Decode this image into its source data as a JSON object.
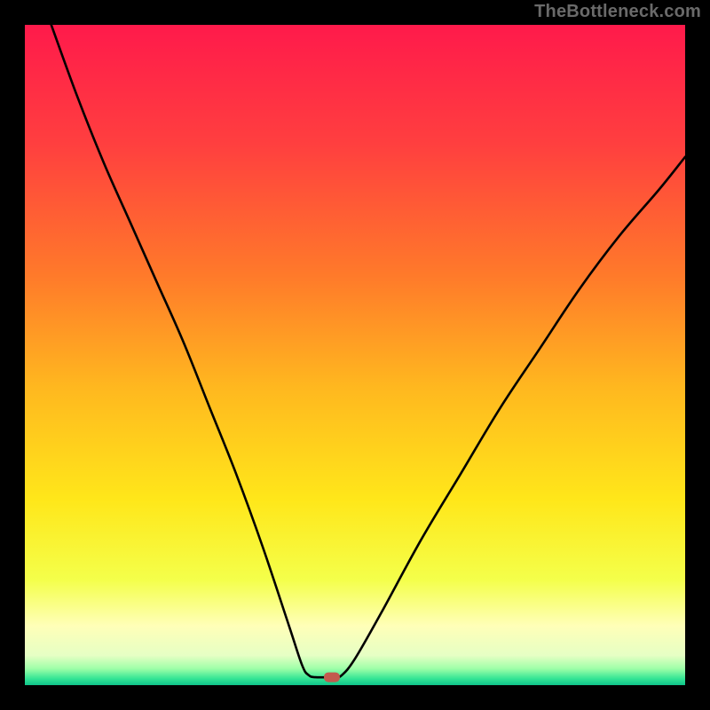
{
  "watermark": "TheBottleneck.com",
  "chart_data": {
    "type": "line",
    "title": "",
    "xlabel": "",
    "ylabel": "",
    "xlim": [
      0,
      100
    ],
    "ylim": [
      0,
      100
    ],
    "grid": false,
    "legend": false,
    "curve_points": [
      {
        "x": 4,
        "y": 100
      },
      {
        "x": 8,
        "y": 89
      },
      {
        "x": 12,
        "y": 79
      },
      {
        "x": 16,
        "y": 70
      },
      {
        "x": 20,
        "y": 61
      },
      {
        "x": 24,
        "y": 52
      },
      {
        "x": 28,
        "y": 42
      },
      {
        "x": 32,
        "y": 32
      },
      {
        "x": 36,
        "y": 21
      },
      {
        "x": 40,
        "y": 9
      },
      {
        "x": 42,
        "y": 3
      },
      {
        "x": 43,
        "y": 1.5
      },
      {
        "x": 44,
        "y": 1.2
      },
      {
        "x": 46,
        "y": 1.2
      },
      {
        "x": 47,
        "y": 1.2
      },
      {
        "x": 48,
        "y": 1.5
      },
      {
        "x": 50,
        "y": 4
      },
      {
        "x": 54,
        "y": 11
      },
      {
        "x": 60,
        "y": 22
      },
      {
        "x": 66,
        "y": 32
      },
      {
        "x": 72,
        "y": 42
      },
      {
        "x": 78,
        "y": 51
      },
      {
        "x": 84,
        "y": 60
      },
      {
        "x": 90,
        "y": 68
      },
      {
        "x": 96,
        "y": 75
      },
      {
        "x": 100,
        "y": 80
      }
    ],
    "marker": {
      "x": 46.5,
      "y": 1.2,
      "color": "#c35a4e"
    },
    "background_gradient": {
      "stops": [
        {
          "offset": 0.0,
          "color": "#ff1a4b"
        },
        {
          "offset": 0.18,
          "color": "#ff3f3f"
        },
        {
          "offset": 0.38,
          "color": "#ff7a2a"
        },
        {
          "offset": 0.55,
          "color": "#ffb81f"
        },
        {
          "offset": 0.72,
          "color": "#ffe71a"
        },
        {
          "offset": 0.84,
          "color": "#f4ff4a"
        },
        {
          "offset": 0.91,
          "color": "#ffffb8"
        },
        {
          "offset": 0.955,
          "color": "#e6ffc4"
        },
        {
          "offset": 0.975,
          "color": "#9effa8"
        },
        {
          "offset": 0.99,
          "color": "#35e595"
        },
        {
          "offset": 1.0,
          "color": "#0fc48a"
        }
      ]
    }
  }
}
